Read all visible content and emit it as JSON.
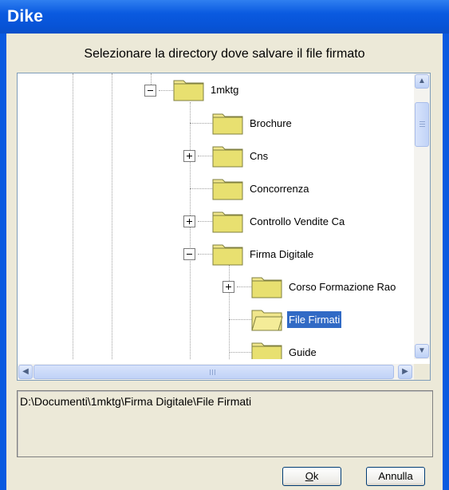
{
  "window": {
    "title": "Dike"
  },
  "dialog": {
    "prompt": "Selezionare la directory dove salvare il file firmato"
  },
  "tree": {
    "nodes": [
      {
        "label": "1mktg",
        "expander": "minus"
      },
      {
        "label": "Brochure",
        "expander": "none"
      },
      {
        "label": "Cns",
        "expander": "plus"
      },
      {
        "label": "Concorrenza",
        "expander": "none"
      },
      {
        "label": "Controllo Vendite Ca",
        "expander": "plus"
      },
      {
        "label": "Firma Digitale",
        "expander": "minus"
      },
      {
        "label": "Corso Formazione Rao",
        "expander": "plus"
      },
      {
        "label": "File Firmati",
        "expander": "none",
        "selected": true
      },
      {
        "label": "Guide",
        "expander": "none"
      }
    ],
    "folder_color": "#f0e68c",
    "selection_color": "#316ac5"
  },
  "path": {
    "value": "D:\\Documenti\\1mktg\\Firma Digitale\\File Firmati"
  },
  "buttons": {
    "ok_label": "Ok",
    "ok_mnemonic": "O",
    "ok_rest": "k",
    "cancel_label": "Annulla"
  },
  "icons": {
    "scroll_up": "chevron-up-icon",
    "scroll_down": "chevron-down-icon",
    "scroll_left": "chevron-left-icon",
    "scroll_right": "chevron-right-icon"
  }
}
